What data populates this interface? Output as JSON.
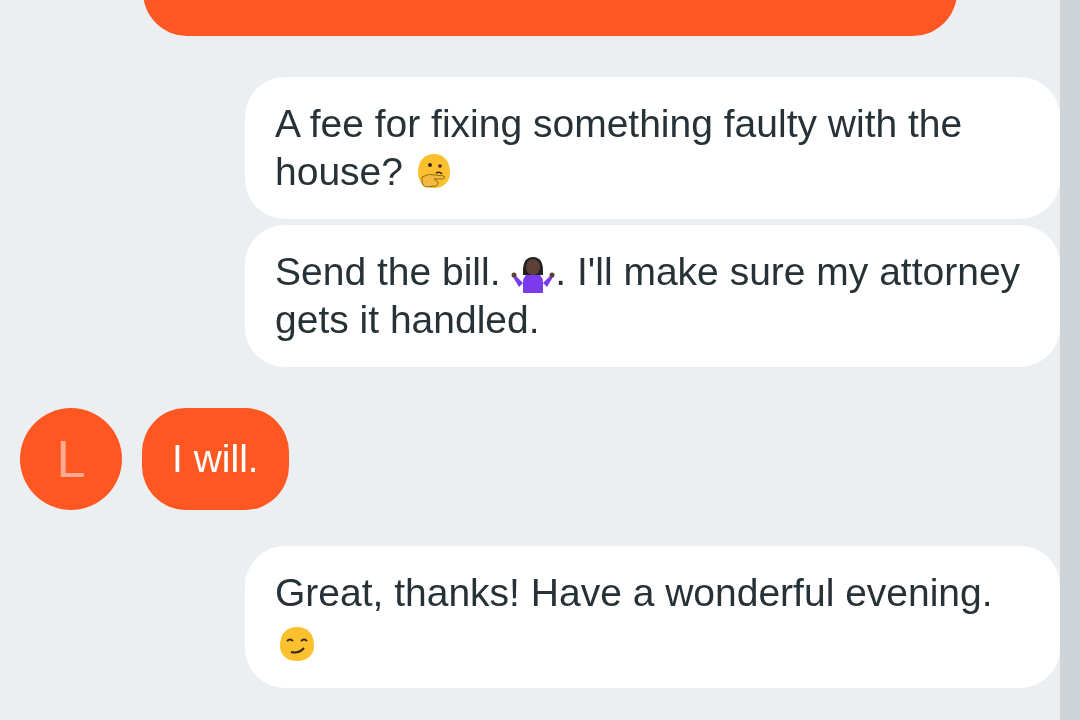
{
  "messages": [
    {
      "incoming": true,
      "kind": "partial"
    },
    {
      "incoming": false,
      "parts": [
        {
          "kind": "text",
          "text": "A fee for fixing something faulty with the house? "
        },
        {
          "kind": "thinking"
        }
      ]
    },
    {
      "incoming": false,
      "parts": [
        {
          "kind": "text",
          "text": "Send the bill. "
        },
        {
          "kind": "shrug"
        },
        {
          "kind": "text",
          "text": ". I'll make sure my attorney gets it handled."
        }
      ]
    },
    {
      "incoming": true,
      "avatar": "L",
      "parts": [
        {
          "kind": "text",
          "text": "I will."
        }
      ]
    },
    {
      "incoming": false,
      "parts": [
        {
          "kind": "text",
          "text": "Great, thanks! Have a wonderful evening. "
        },
        {
          "kind": "smirk"
        }
      ]
    }
  ]
}
